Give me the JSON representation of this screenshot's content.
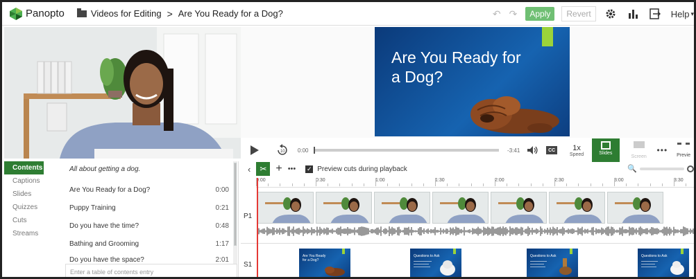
{
  "header": {
    "brand": "Panopto",
    "folder": "Videos for Editing",
    "separator": ">",
    "video_title": "Are You Ready for a Dog?",
    "apply_label": "Apply",
    "revert_label": "Revert",
    "help_label": "Help"
  },
  "slide_preview": {
    "title": "Are You Ready for a Dog?"
  },
  "player": {
    "current_time": "0:00",
    "remaining_time": "-3:41",
    "cc_label": "CC",
    "speed_value": "1x",
    "speed_label": "Speed",
    "slides_label": "Slides",
    "screen_label": "Screen",
    "preview_label": "Previe"
  },
  "tabs": [
    {
      "label": "Contents",
      "active": true
    },
    {
      "label": "Captions"
    },
    {
      "label": "Slides"
    },
    {
      "label": "Quizzes"
    },
    {
      "label": "Cuts"
    },
    {
      "label": "Streams"
    }
  ],
  "toc": {
    "description": "All about getting a dog.",
    "entries": [
      {
        "title": "Are You Ready for a Dog?",
        "time": "0:00"
      },
      {
        "title": "Puppy Training",
        "time": "0:21"
      },
      {
        "title": "Do you have the time?",
        "time": "0:48"
      },
      {
        "title": "Bathing and Grooming",
        "time": "1:17"
      },
      {
        "title": "Do you have the space?",
        "time": "2:01"
      }
    ],
    "input_placeholder": "Enter a table of contents entry"
  },
  "editor": {
    "preview_cuts_label": "Preview cuts during playback",
    "preview_cuts_checked": true
  },
  "timeline": {
    "ticks": [
      "0:00",
      "0:30",
      "1:00",
      "1:30",
      "2:00",
      "2:30",
      "3:00",
      "3:30"
    ],
    "track_p1": "P1",
    "track_s1": "S1",
    "slide_thumbs": [
      {
        "title": "Are You Ready for a Dog?"
      },
      {
        "title": "Questions to Ask"
      },
      {
        "title": "Questions to Ask"
      },
      {
        "title": "Questions to Ask"
      }
    ]
  },
  "colors": {
    "accent_green": "#2e7d32",
    "apply_green": "#6fbf73",
    "slide_blue": "#1663b0",
    "slide_accent": "#9bd33a",
    "playhead_red": "#e53935"
  }
}
